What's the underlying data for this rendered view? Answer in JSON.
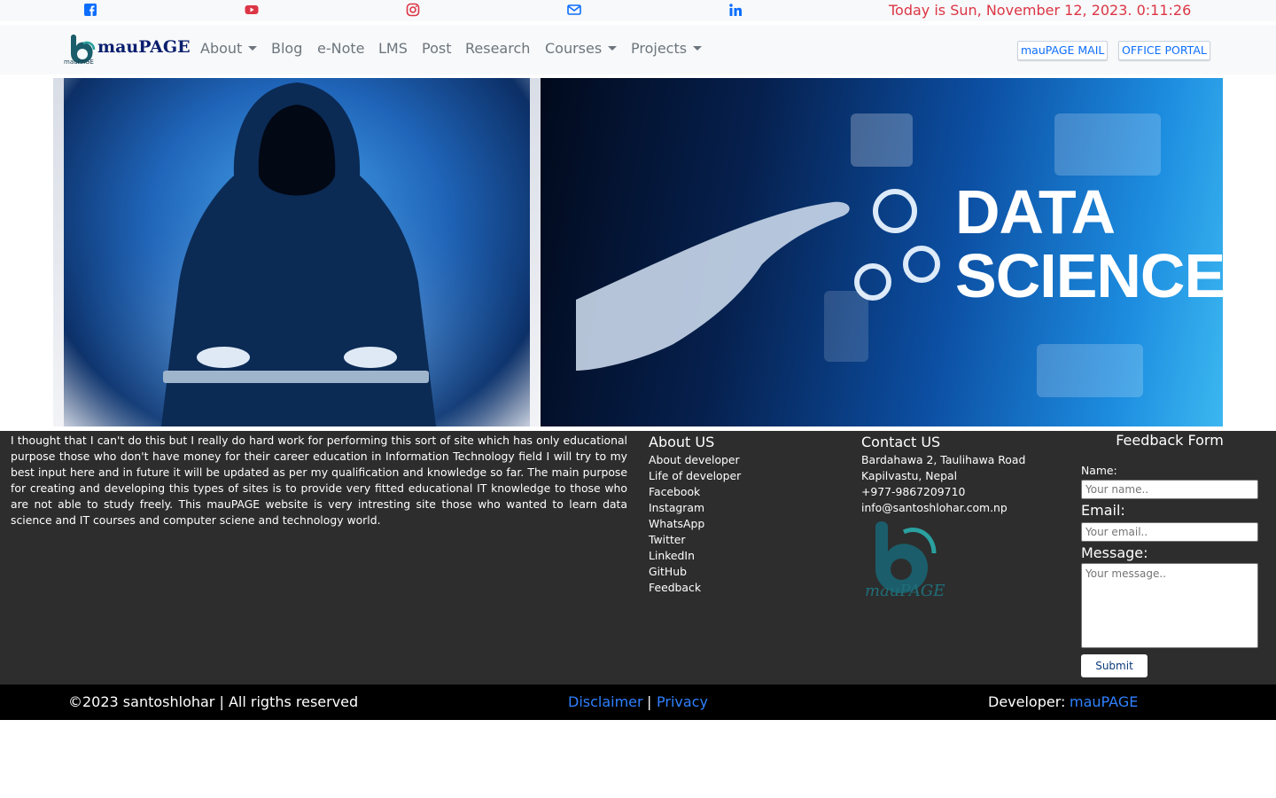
{
  "topbar": {
    "icons": [
      "facebook-icon",
      "youtube-icon",
      "instagram-icon",
      "mail-icon",
      "linkedin-icon"
    ],
    "date_text": "Today is Sun, November 12, 2023. 0:11:26",
    "icon_color": "#0d6efd",
    "date_color": "#dc3545"
  },
  "navbar": {
    "brand": "mauPAGE",
    "brand_small": "mauPAGE",
    "items": [
      {
        "label": "About",
        "dropdown": true
      },
      {
        "label": "Blog",
        "dropdown": false
      },
      {
        "label": "e-Note",
        "dropdown": false
      },
      {
        "label": "LMS",
        "dropdown": false
      },
      {
        "label": "Post",
        "dropdown": false
      },
      {
        "label": "Research",
        "dropdown": false
      },
      {
        "label": "Courses",
        "dropdown": true
      },
      {
        "label": "Projects",
        "dropdown": true
      }
    ],
    "buttons": [
      "mauPAGE MAIL",
      "OFFICE PORTAL"
    ]
  },
  "hero": {
    "right_text_line1": "DATA",
    "right_text_line2": "SCIENCE"
  },
  "footer": {
    "about_text": "I thought that I can't do this but I really do hard work for performing this sort of site which has only educational purpose those who don't have money for their career education in Information Technology field I will try to my best input here and in future it will be updated as per my qualification and knowledge so far. The main purpose for creating and developing this types of sites is to provide very fitted educational IT knowledge to those who are not able to study freely. This mauPAGE website is very intresting site those who wanted to learn data science and IT courses and computer sciene and technology world.",
    "about_us": {
      "title": "About US",
      "links": [
        "About developer",
        "Life of developer",
        "Facebook",
        "Instagram",
        "WhatsApp",
        "Twitter",
        "LinkedIn",
        "GitHub",
        "Feedback"
      ]
    },
    "contact_us": {
      "title": "Contact US",
      "address_line1": "Bardahawa 2, Taulihawa Road",
      "address_line2": "Kapilvastu, Nepal",
      "phone": "+977-9867209710",
      "email": "info@santoshlohar.com.np",
      "logo_text": "mauPAGE"
    },
    "feedback_form": {
      "title": "Feedback Form",
      "name_label": "Name:",
      "name_placeholder": "Your name..",
      "email_label": "Email:",
      "email_placeholder": "Your email..",
      "message_label": "Message:",
      "message_placeholder": "Your message..",
      "submit_label": "Submit"
    }
  },
  "bottombar": {
    "copyright": "©2023 santoshlohar | All rigths reserved",
    "disclaimer": "Disclaimer",
    "separator": "|",
    "privacy": "Privacy",
    "developer_label": "Developer:",
    "developer_link": "mauPAGE"
  }
}
